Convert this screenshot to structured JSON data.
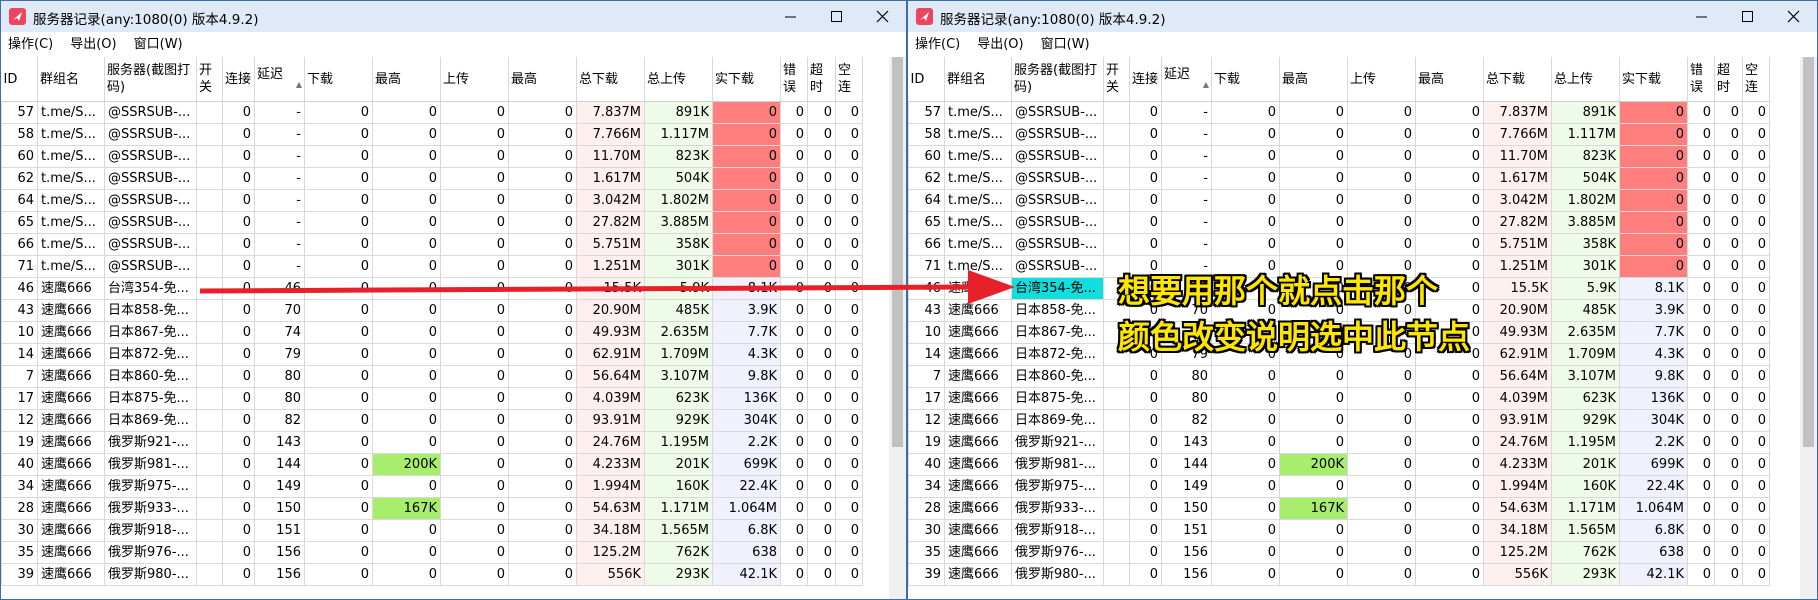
{
  "window": {
    "title": "服务器记录(any:1080(0) 版本4.9.2)",
    "menu": [
      "操作(C)",
      "导出(O)",
      "窗口(W)"
    ]
  },
  "columns": [
    "ID",
    "群组名",
    "服务器(截图打码)",
    "开关",
    "连接",
    "延迟",
    "下载",
    "最高",
    "上传",
    "最高",
    "总下载",
    "总上传",
    "实下载",
    "错误",
    "超时",
    "空连"
  ],
  "rows": [
    [
      "57",
      "t.me/S...",
      "@SSRSUB-...",
      "",
      "0",
      "-",
      "0",
      "0",
      "0",
      "0",
      "7.837M",
      "891K",
      "0",
      "0",
      "0",
      "0"
    ],
    [
      "58",
      "t.me/S...",
      "@SSRSUB-...",
      "",
      "0",
      "-",
      "0",
      "0",
      "0",
      "0",
      "7.766M",
      "1.117M",
      "0",
      "0",
      "0",
      "0"
    ],
    [
      "60",
      "t.me/S...",
      "@SSRSUB-...",
      "",
      "0",
      "-",
      "0",
      "0",
      "0",
      "0",
      "11.70M",
      "823K",
      "0",
      "0",
      "0",
      "0"
    ],
    [
      "62",
      "t.me/S...",
      "@SSRSUB-...",
      "",
      "0",
      "-",
      "0",
      "0",
      "0",
      "0",
      "1.617M",
      "504K",
      "0",
      "0",
      "0",
      "0"
    ],
    [
      "64",
      "t.me/S...",
      "@SSRSUB-...",
      "",
      "0",
      "-",
      "0",
      "0",
      "0",
      "0",
      "3.042M",
      "1.802M",
      "0",
      "0",
      "0",
      "0"
    ],
    [
      "65",
      "t.me/S...",
      "@SSRSUB-...",
      "",
      "0",
      "-",
      "0",
      "0",
      "0",
      "0",
      "27.82M",
      "3.885M",
      "0",
      "0",
      "0",
      "0"
    ],
    [
      "66",
      "t.me/S...",
      "@SSRSUB-...",
      "",
      "0",
      "-",
      "0",
      "0",
      "0",
      "0",
      "5.751M",
      "358K",
      "0",
      "0",
      "0",
      "0"
    ],
    [
      "71",
      "t.me/S...",
      "@SSRSUB-...",
      "",
      "0",
      "-",
      "0",
      "0",
      "0",
      "0",
      "1.251M",
      "301K",
      "0",
      "0",
      "0",
      "0"
    ],
    [
      "46",
      "速鹰666",
      "台湾354-免...",
      "",
      "0",
      "46",
      "0",
      "0",
      "0",
      "0",
      "15.5K",
      "5.9K",
      "8.1K",
      "0",
      "0",
      "0"
    ],
    [
      "43",
      "速鹰666",
      "日本858-免...",
      "",
      "0",
      "70",
      "0",
      "0",
      "0",
      "0",
      "20.90M",
      "485K",
      "3.9K",
      "0",
      "0",
      "0"
    ],
    [
      "10",
      "速鹰666",
      "日本867-免...",
      "",
      "0",
      "74",
      "0",
      "0",
      "0",
      "0",
      "49.93M",
      "2.635M",
      "7.7K",
      "0",
      "0",
      "0"
    ],
    [
      "14",
      "速鹰666",
      "日本872-免...",
      "",
      "0",
      "79",
      "0",
      "0",
      "0",
      "0",
      "62.91M",
      "1.709M",
      "4.3K",
      "0",
      "0",
      "0"
    ],
    [
      "7",
      "速鹰666",
      "日本860-免...",
      "",
      "0",
      "80",
      "0",
      "0",
      "0",
      "0",
      "56.64M",
      "3.107M",
      "9.8K",
      "0",
      "0",
      "0"
    ],
    [
      "17",
      "速鹰666",
      "日本875-免...",
      "",
      "0",
      "80",
      "0",
      "0",
      "0",
      "0",
      "4.039M",
      "623K",
      "136K",
      "0",
      "0",
      "0"
    ],
    [
      "12",
      "速鹰666",
      "日本869-免...",
      "",
      "0",
      "82",
      "0",
      "0",
      "0",
      "0",
      "93.91M",
      "929K",
      "304K",
      "0",
      "0",
      "0"
    ],
    [
      "19",
      "速鹰666",
      "俄罗斯921-...",
      "",
      "0",
      "143",
      "0",
      "0",
      "0",
      "0",
      "24.76M",
      "1.195M",
      "2.2K",
      "0",
      "0",
      "0"
    ],
    [
      "40",
      "速鹰666",
      "俄罗斯981-...",
      "",
      "0",
      "144",
      "0",
      "200K",
      "0",
      "0",
      "4.233M",
      "201K",
      "699K",
      "0",
      "0",
      "0"
    ],
    [
      "34",
      "速鹰666",
      "俄罗斯975-...",
      "",
      "0",
      "149",
      "0",
      "0",
      "0",
      "0",
      "1.994M",
      "160K",
      "22.4K",
      "0",
      "0",
      "0"
    ],
    [
      "28",
      "速鹰666",
      "俄罗斯933-...",
      "",
      "0",
      "150",
      "0",
      "167K",
      "0",
      "0",
      "54.63M",
      "1.171M",
      "1.064M",
      "0",
      "0",
      "0"
    ],
    [
      "30",
      "速鹰666",
      "俄罗斯918-...",
      "",
      "0",
      "151",
      "0",
      "0",
      "0",
      "0",
      "34.18M",
      "1.565M",
      "6.8K",
      "0",
      "0",
      "0"
    ],
    [
      "35",
      "速鹰666",
      "俄罗斯976-...",
      "",
      "0",
      "156",
      "0",
      "0",
      "0",
      "0",
      "125.2M",
      "762K",
      "638",
      "0",
      "0",
      "0"
    ],
    [
      "39",
      "速鹰666",
      "俄罗斯980-...",
      "",
      "0",
      "156",
      "0",
      "0",
      "0",
      "0",
      "556K",
      "293K",
      "42.1K",
      "0",
      "0",
      "0"
    ]
  ],
  "selected_row_right": 8,
  "annotation": {
    "line1": "想要用那个就点击那个",
    "line2": "颜色改变说明选中此节点"
  },
  "colors": {
    "red_cell": "#ff7f7f",
    "green_cell": "#a6ee6b",
    "selected_cell": "#11dede",
    "arrow": "#e8202a",
    "annotation_text": "#ffe600"
  }
}
